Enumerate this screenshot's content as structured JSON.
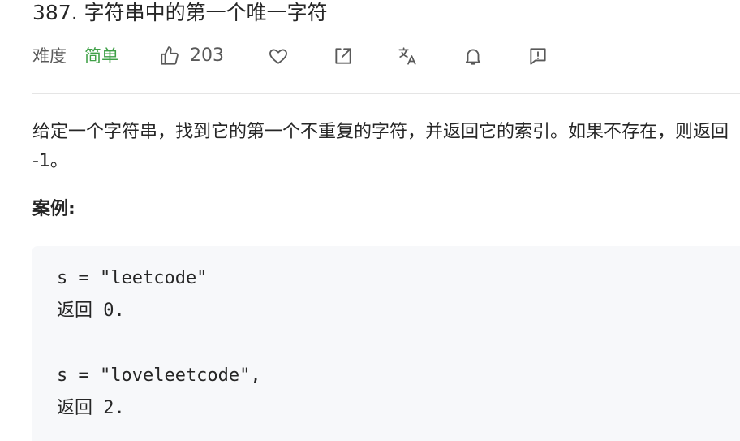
{
  "problem": {
    "title": "387. 字符串中的第一个唯一字符",
    "difficulty_label": "难度",
    "difficulty_value": "简单",
    "like_count": "203",
    "icons": [
      "thumbs-up-icon",
      "heart-icon",
      "share-icon",
      "translate-icon",
      "bell-icon",
      "feedback-icon"
    ],
    "description": "给定一个字符串，找到它的第一个不重复的字符，并返回它的索引。如果不存在，则返回 -1。",
    "example_heading": "案例:",
    "example_lines": [
      "s = \"leetcode\"",
      "返回 0.",
      "s = \"loveleetcode\",",
      "返回 2."
    ]
  },
  "colors": {
    "difficulty_easy": "#3fa047",
    "text": "#262626",
    "muted": "#595959",
    "code_bg": "#f7f8fa"
  }
}
